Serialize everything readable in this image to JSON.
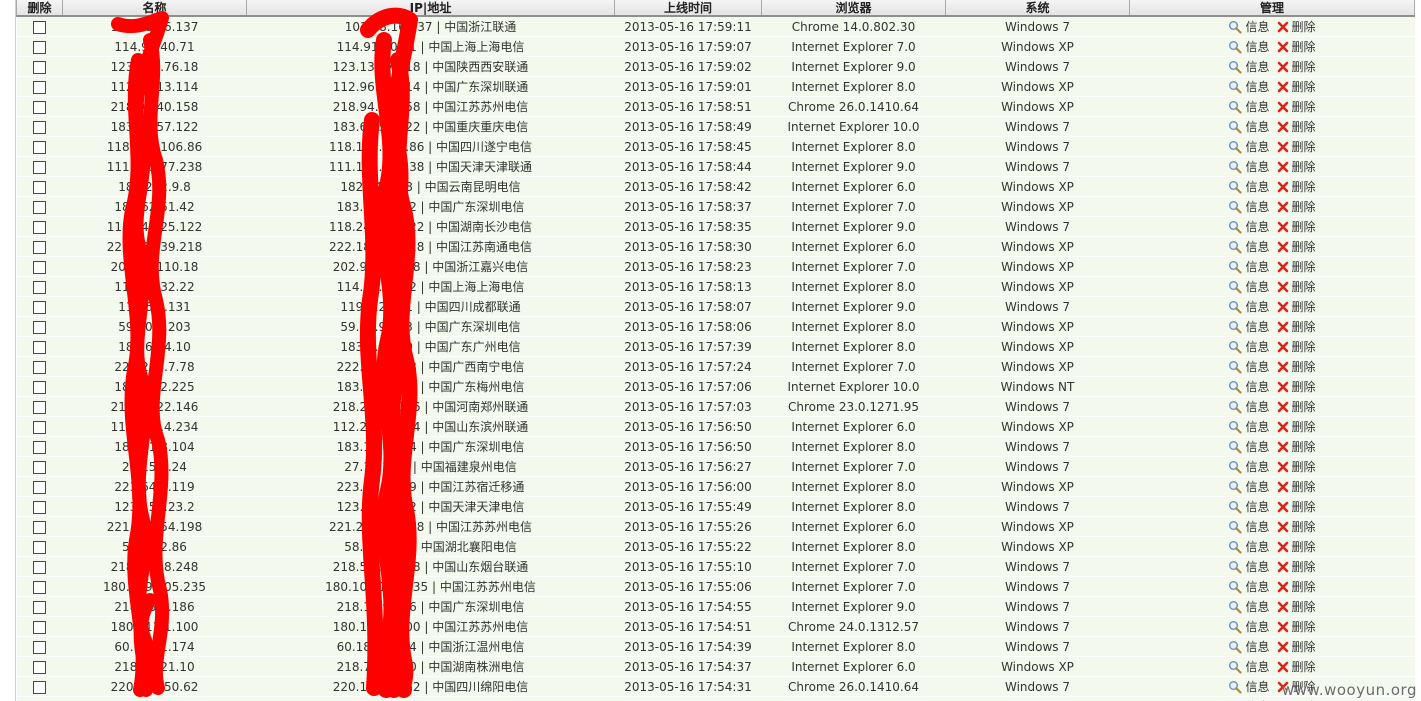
{
  "columns": {
    "delete": "删除",
    "name": "名称",
    "ip": "IP|地址",
    "online_time": "上线时间",
    "browser": "浏览器",
    "os": "系统",
    "manage": "管理"
  },
  "actions": {
    "info_label": "信息",
    "delete_label": "删除"
  },
  "rows": [
    {
      "name": "101.68.16.137",
      "ip": "101.68.16.137 | 中国浙江联通",
      "time": "2013-05-16 17:59:11",
      "browser": "Chrome 14.0.802.30",
      "os": "Windows 7"
    },
    {
      "name": "114.91.40.71",
      "ip": "114.91.40.71 | 中国上海上海电信",
      "time": "2013-05-16 17:59:07",
      "browser": "Internet Explorer 7.0",
      "os": "Windows XP"
    },
    {
      "name": "123.139.76.18",
      "ip": "123.139.76.18 | 中国陕西西安联通",
      "time": "2013-05-16 17:59:02",
      "browser": "Internet Explorer 9.0",
      "os": "Windows 7"
    },
    {
      "name": "112.96.13.114",
      "ip": "112.96.13.114 | 中国广东深圳联通",
      "time": "2013-05-16 17:59:01",
      "browser": "Internet Explorer 8.0",
      "os": "Windows XP"
    },
    {
      "name": "218.94.40.158",
      "ip": "218.94.40.158 | 中国江苏苏州电信",
      "time": "2013-05-16 17:58:51",
      "browser": "Chrome 26.0.1410.64",
      "os": "Windows XP"
    },
    {
      "name": "183.64.57.122",
      "ip": "183.64.57.122 | 中国重庆重庆电信",
      "time": "2013-05-16 17:58:49",
      "browser": "Internet Explorer 10.0",
      "os": "Windows 7"
    },
    {
      "name": "118.112.106.86",
      "ip": "118.112.106.86 | 中国四川遂宁电信",
      "time": "2013-05-16 17:58:45",
      "browser": "Internet Explorer 8.0",
      "os": "Windows 7"
    },
    {
      "name": "111.163.77.238",
      "ip": "111.163.77.238 | 中国天津天津联通",
      "time": "2013-05-16 17:58:44",
      "browser": "Internet Explorer 9.0",
      "os": "Windows 7"
    },
    {
      "name": "182.242.9.8",
      "ip": "182.242.9.8 | 中国云南昆明电信",
      "time": "2013-05-16 17:58:42",
      "browser": "Internet Explorer 6.0",
      "os": "Windows XP"
    },
    {
      "name": "183.62.51.42",
      "ip": "183.62.51.42 | 中国广东深圳电信",
      "time": "2013-05-16 17:58:37",
      "browser": "Internet Explorer 7.0",
      "os": "Windows XP"
    },
    {
      "name": "118.249.25.122",
      "ip": "118.249.25.122 | 中国湖南长沙电信",
      "time": "2013-05-16 17:58:35",
      "browser": "Internet Explorer 9.0",
      "os": "Windows 7"
    },
    {
      "name": "222.185.39.218",
      "ip": "222.185.39.218 | 中国江苏南通电信",
      "time": "2013-05-16 17:58:30",
      "browser": "Internet Explorer 6.0",
      "os": "Windows XP"
    },
    {
      "name": "202.96.110.18",
      "ip": "202.96.110.18 | 中国浙江嘉兴电信",
      "time": "2013-05-16 17:58:23",
      "browser": "Internet Explorer 7.0",
      "os": "Windows XP"
    },
    {
      "name": "114.86.32.22",
      "ip": "114.86.32.22 | 中国上海上海电信",
      "time": "2013-05-16 17:58:13",
      "browser": "Internet Explorer 8.0",
      "os": "Windows XP"
    },
    {
      "name": "119.6.2.131",
      "ip": "119.6.2.131 | 中国四川成都联通",
      "time": "2013-05-16 17:58:07",
      "browser": "Internet Explorer 9.0",
      "os": "Windows 7"
    },
    {
      "name": "59.40.9.203",
      "ip": "59.40.9.203 | 中国广东深圳电信",
      "time": "2013-05-16 17:58:06",
      "browser": "Internet Explorer 8.0",
      "os": "Windows XP"
    },
    {
      "name": "183.6.44.10",
      "ip": "183.6.44.10 | 中国广东广州电信",
      "time": "2013-05-16 17:57:39",
      "browser": "Internet Explorer 8.0",
      "os": "Windows XP"
    },
    {
      "name": "222.216.7.78",
      "ip": "222.216.7.78 | 中国广西南宁电信",
      "time": "2013-05-16 17:57:24",
      "browser": "Internet Explorer 7.0",
      "os": "Windows XP"
    },
    {
      "name": "183.58.2.225",
      "ip": "183.58.2.225 | 中国广东梅州电信",
      "time": "2013-05-16 17:57:06",
      "browser": "Internet Explorer 10.0",
      "os": "Windows NT"
    },
    {
      "name": "218.28.22.146",
      "ip": "218.28.22.146 | 中国河南郑州联通",
      "time": "2013-05-16 17:57:03",
      "browser": "Chrome 23.0.1271.95",
      "os": "Windows 7"
    },
    {
      "name": "112.245.4.234",
      "ip": "112.245.4.234 | 中国山东滨州联通",
      "time": "2013-05-16 17:56:50",
      "browser": "Internet Explorer 6.0",
      "os": "Windows XP"
    },
    {
      "name": "183.11.8.104",
      "ip": "183.11.8.104 | 中国广东深圳电信",
      "time": "2013-05-16 17:56:50",
      "browser": "Internet Explorer 8.0",
      "os": "Windows 7"
    },
    {
      "name": "27.15.2.24",
      "ip": "27.15.2.24 | 中国福建泉州电信",
      "time": "2013-05-16 17:56:27",
      "browser": "Internet Explorer 7.0",
      "os": "Windows 7"
    },
    {
      "name": "223.64.5.119",
      "ip": "223.64.5.119 | 中国江苏宿迁移通",
      "time": "2013-05-16 17:56:00",
      "browser": "Internet Explorer 8.0",
      "os": "Windows XP"
    },
    {
      "name": "123.150.23.2",
      "ip": "123.150.23.2 | 中国天津天津电信",
      "time": "2013-05-16 17:55:49",
      "browser": "Internet Explorer 8.0",
      "os": "Windows 7"
    },
    {
      "name": "221.224.54.198",
      "ip": "221.224.54.198 | 中国江苏苏州电信",
      "time": "2013-05-16 17:55:26",
      "browser": "Internet Explorer 6.0",
      "os": "Windows XP"
    },
    {
      "name": "58.51.2.86",
      "ip": "58.51.2.86 | 中国湖北襄阳电信",
      "time": "2013-05-16 17:55:22",
      "browser": "Internet Explorer 8.0",
      "os": "Windows XP"
    },
    {
      "name": "218.56.38.248",
      "ip": "218.56.38.248 | 中国山东烟台联通",
      "time": "2013-05-16 17:55:10",
      "browser": "Internet Explorer 7.0",
      "os": "Windows 7"
    },
    {
      "name": "180.109.105.235",
      "ip": "180.109.105.235 | 中国江苏苏州电信",
      "time": "2013-05-16 17:55:06",
      "browser": "Internet Explorer 7.0",
      "os": "Windows 7"
    },
    {
      "name": "218.18.9.186",
      "ip": "218.18.9.186 | 中国广东深圳电信",
      "time": "2013-05-16 17:54:55",
      "browser": "Internet Explorer 9.0",
      "os": "Windows 7"
    },
    {
      "name": "180.111.1.100",
      "ip": "180.111.1.100 | 中国江苏苏州电信",
      "time": "2013-05-16 17:54:51",
      "browser": "Chrome 24.0.1312.57",
      "os": "Windows 7"
    },
    {
      "name": "60.181.1.174",
      "ip": "60.181.1.174 | 中国浙江温州电信",
      "time": "2013-05-16 17:54:39",
      "browser": "Internet Explorer 8.0",
      "os": "Windows 7"
    },
    {
      "name": "218.75.21.10",
      "ip": "218.75.21.10 | 中国湖南株洲电信",
      "time": "2013-05-16 17:54:37",
      "browser": "Internet Explorer 6.0",
      "os": "Windows XP"
    },
    {
      "name": "220.166.50.62",
      "ip": "220.166.50.62 | 中国四川绵阳电信",
      "time": "2013-05-16 17:54:31",
      "browser": "Chrome 26.0.1410.64",
      "os": "Windows 7"
    },
    {
      "name": "",
      "ip": "",
      "time": "",
      "browser": "",
      "os": ""
    }
  ],
  "watermark": "www.wooyun.org",
  "colors": {
    "row_bg": "#f3f9ec",
    "header_bg": "#e3e3e3",
    "redaction": "#ff0000",
    "delete_x": "#d9261c"
  }
}
